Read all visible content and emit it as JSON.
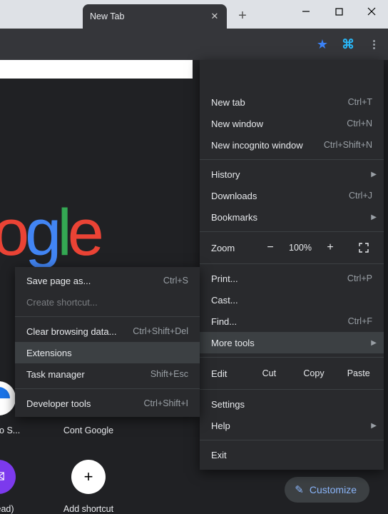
{
  "window": {
    "tab_title": "New Tab"
  },
  "menu": {
    "new_tab": {
      "label": "New tab",
      "shortcut": "Ctrl+T"
    },
    "new_window": {
      "label": "New window",
      "shortcut": "Ctrl+N"
    },
    "incognito": {
      "label": "New incognito window",
      "shortcut": "Ctrl+Shift+N"
    },
    "history": {
      "label": "History"
    },
    "downloads": {
      "label": "Downloads",
      "shortcut": "Ctrl+J"
    },
    "bookmarks": {
      "label": "Bookmarks"
    },
    "zoom_label": "Zoom",
    "zoom_minus": "−",
    "zoom_pct": "100%",
    "zoom_plus": "+",
    "print": {
      "label": "Print...",
      "shortcut": "Ctrl+P"
    },
    "cast": {
      "label": "Cast..."
    },
    "find": {
      "label": "Find...",
      "shortcut": "Ctrl+F"
    },
    "more_tools": {
      "label": "More tools"
    },
    "edit_label": "Edit",
    "cut": "Cut",
    "copy": "Copy",
    "paste": "Paste",
    "settings": {
      "label": "Settings"
    },
    "help": {
      "label": "Help"
    },
    "exit": {
      "label": "Exit"
    }
  },
  "submenu": {
    "save_page": {
      "label": "Save page as...",
      "shortcut": "Ctrl+S"
    },
    "create_shortcut": {
      "label": "Create shortcut..."
    },
    "clear_data": {
      "label": "Clear browsing data...",
      "shortcut": "Ctrl+Shift+Del"
    },
    "extensions": {
      "label": "Extensions"
    },
    "task_manager": {
      "label": "Task manager",
      "shortcut": "Shift+Esc"
    },
    "dev_tools": {
      "label": "Developer tools",
      "shortcut": "Ctrl+Shift+I"
    }
  },
  "shortcuts": {
    "row1": [
      {
        "label": "ome to S..."
      },
      {
        "label": "Cont Google"
      }
    ],
    "row2": [
      {
        "label": "unread)",
        "icon": "mail"
      },
      {
        "label": "Add shortcut",
        "icon": "plus"
      }
    ]
  },
  "customize": {
    "label": "Customize"
  },
  "logo": {
    "o1": "o",
    "g": "g",
    "l": "l",
    "e": "e"
  }
}
